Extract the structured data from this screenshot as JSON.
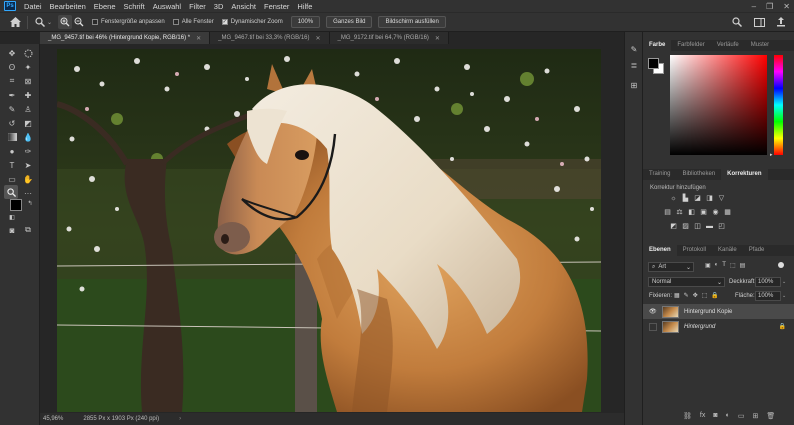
{
  "menubar": {
    "logo": "Ps",
    "items": [
      "Datei",
      "Bearbeiten",
      "Ebene",
      "Schrift",
      "Auswahl",
      "Filter",
      "3D",
      "Ansicht",
      "Fenster",
      "Hilfe"
    ],
    "window_controls": [
      "–",
      "❐",
      "✕"
    ]
  },
  "options": {
    "fit_window": "Fenstergröße anpassen",
    "all_windows": "Alle Fenster",
    "scrubby_zoom": "Dynamischer Zoom",
    "zoom_100": "100%",
    "fit_screen": "Ganzes Bild",
    "fill_screen": "Bildschirm ausfüllen"
  },
  "tabs": [
    {
      "label": "_MG_9457.tif bei 46% (Hintergrund Kopie, RGB/16) *",
      "active": true
    },
    {
      "label": "_MG_9467.tif bei 33,3% (RGB/16)",
      "active": false
    },
    {
      "label": "_MG_9172.tif bei 64,7% (RGB/16)",
      "active": false
    }
  ],
  "status": {
    "zoom": "45,96%",
    "dimensions": "2855 Px x 1903 Px (240 ppi)"
  },
  "color_panel": {
    "tabs": [
      "Farbe",
      "Farbfelder",
      "Verläufe",
      "Muster"
    ],
    "hue_color": "#ff0000",
    "foreground": "#000000",
    "background": "#ffffff"
  },
  "adjustments_panel": {
    "tabs": [
      "Training",
      "Bibliotheken",
      "Korrekturen"
    ],
    "hint": "Korrektur hinzufügen"
  },
  "layers_panel": {
    "tabs": [
      "Ebenen",
      "Protokoll",
      "Kanäle",
      "Pfade"
    ],
    "filter": "Art",
    "blend_mode": "Normal",
    "opacity_label": "Deckkraft:",
    "opacity_value": "100%",
    "lock_label": "Fixieren:",
    "fill_label": "Fläche:",
    "fill_value": "100%",
    "layers": [
      {
        "name": "Hintergrund Kopie",
        "visible": true,
        "selected": true
      },
      {
        "name": "Hintergrund",
        "visible": false,
        "selected": false
      }
    ]
  }
}
